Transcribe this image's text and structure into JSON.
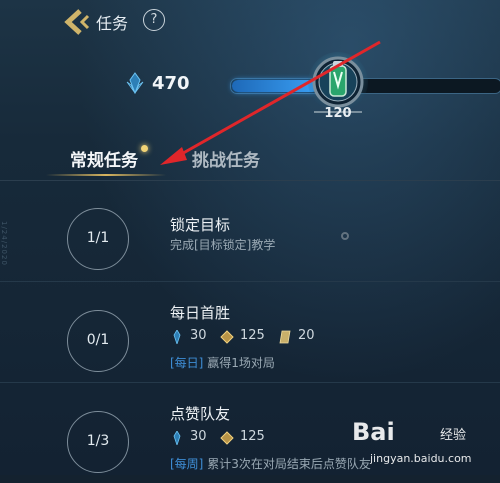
{
  "header": {
    "title": "任务",
    "help_label": "?"
  },
  "currency": {
    "value": "470",
    "icon": "crystal-icon"
  },
  "level": {
    "value": "120",
    "progress_fraction": 0.32
  },
  "tabs": [
    {
      "label": "常规任务",
      "active": true
    },
    {
      "label": "挑战任务",
      "active": false
    }
  ],
  "side_stamp": "1/24/2020",
  "tasks": [
    {
      "progress": "1/1",
      "name": "锁定目标",
      "desc": "完成[目标锁定]教学"
    },
    {
      "progress": "0/1",
      "name": "每日首胜",
      "rewards": [
        {
          "icon": "crystal-icon",
          "value": "30"
        },
        {
          "icon": "gold-diamond-icon",
          "value": "125"
        },
        {
          "icon": "ticket-icon",
          "value": "20"
        }
      ],
      "tag": "[每日]",
      "tag_text": "赢得1场对局"
    },
    {
      "progress": "1/3",
      "name": "点赞队友",
      "rewards": [
        {
          "icon": "crystal-icon",
          "value": "30"
        },
        {
          "icon": "gold-diamond-icon",
          "value": "125"
        }
      ],
      "tag": "[每周]",
      "tag_text": "累计3次在对局结束后点赞队友"
    }
  ],
  "watermark": {
    "main": "Bai",
    "brand": "经验",
    "url": "jingyan.baidu.com"
  },
  "colors": {
    "accent_blue": "#3aa0f5",
    "gold": "#d8b55f",
    "arrow_red": "#e0262a"
  }
}
